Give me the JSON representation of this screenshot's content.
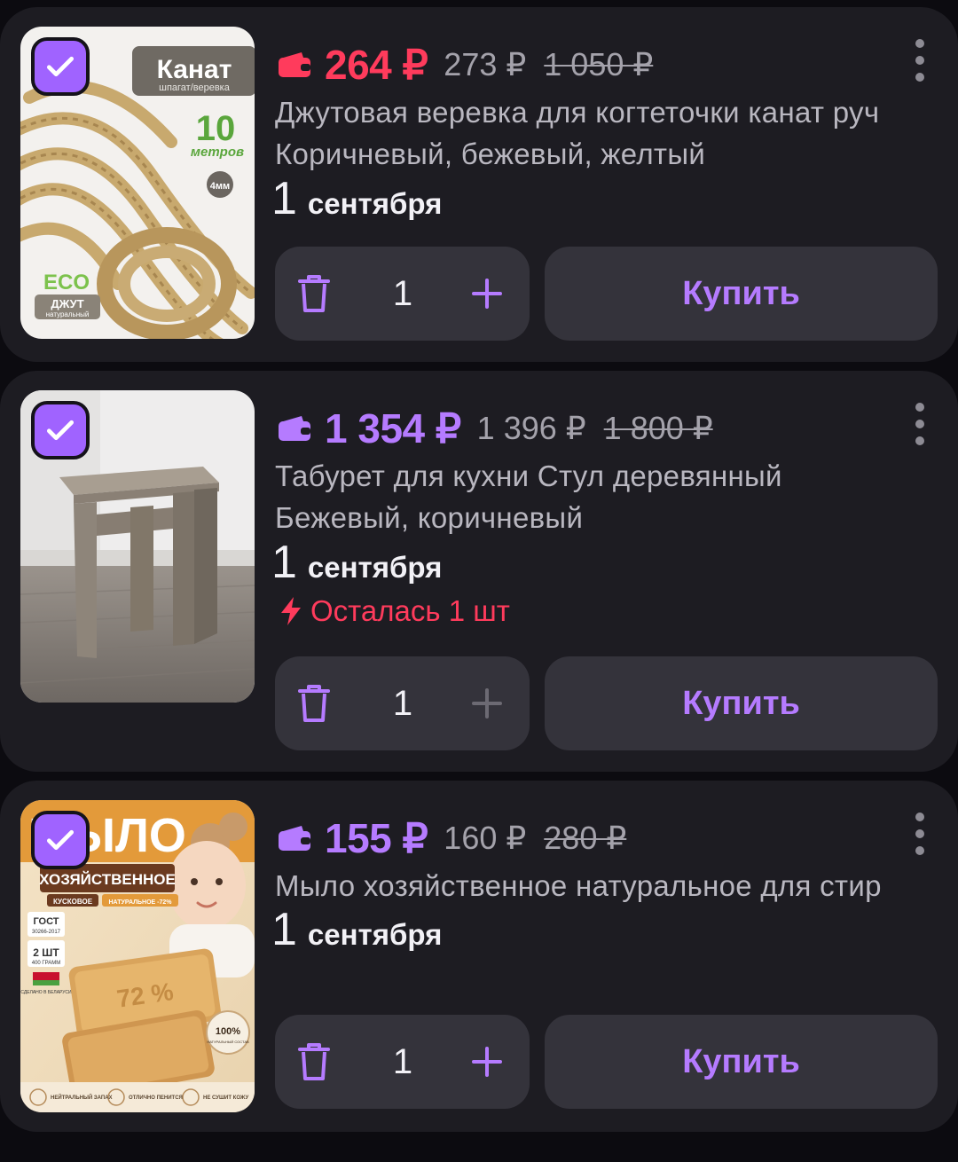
{
  "colors": {
    "background": "#0c0b10",
    "card": "#1d1c22",
    "button": "#34333b",
    "accent_purple": "#b57bff",
    "checkbox": "#a063ff",
    "alert_red": "#ff3b5c"
  },
  "items": [
    {
      "price": "264 ₽",
      "price_color": "red",
      "old_price": "273 ₽",
      "original_price": "1 050 ₽",
      "title": "Джутовая веревка для когтеточки канат руч",
      "variant": "Коричневый, бежевый, желтый",
      "delivery_day": "1",
      "delivery_month": "сентября",
      "stock": "",
      "quantity": "1",
      "buy_label": "Купить",
      "checked": true,
      "image": {
        "brand": "Канат",
        "subtitle": "шпагат/веревка",
        "length": "10",
        "length_unit": "метров",
        "diameter": "4мм",
        "eco": "ECO",
        "material": "ДЖУТ",
        "material_note": "натуральный"
      }
    },
    {
      "price": "1 354 ₽",
      "price_color": "purple",
      "old_price": "1 396 ₽",
      "original_price": "1 800 ₽",
      "title": "Табурет для кухни Стул деревянный",
      "variant": "Бежевый, коричневый",
      "delivery_day": "1",
      "delivery_month": "сентября",
      "stock": "Осталась 1 шт",
      "quantity": "1",
      "buy_label": "Купить",
      "checked": true
    },
    {
      "price": "155 ₽",
      "price_color": "purple",
      "old_price": "160 ₽",
      "original_price": "280 ₽",
      "title": "Мыло хозяйственное натуральное для стир",
      "variant": "",
      "delivery_day": "1",
      "delivery_month": "сентября",
      "stock": "",
      "quantity": "1",
      "buy_label": "Купить",
      "checked": true,
      "image": {
        "brand": "МЫЛО",
        "type": "ХОЗЯЙСТВЕННОЕ",
        "form": "КУСКОВОЕ",
        "natural": "НАТУРАЛЬНОЕ -72%",
        "standard": "ГОСТ",
        "standard_number": "30266-2017",
        "count": "2 ШТ",
        "weight": "400 ГРАММ",
        "origin": "СДЕЛАНО В БЕЛАРУСИ",
        "bar_text": "72 %",
        "badge": "100%",
        "badge_note": "НАТУРАЛЬНЫЙ СОСТАВ",
        "features": [
          "НЕЙТРАЛЬНЫЙ ЗАПАХ",
          "ОТЛИЧНО ПЕНИТСЯ",
          "НЕ СУШИТ КОЖУ"
        ]
      }
    }
  ],
  "icons": {
    "checkbox": "checkmark-icon",
    "wallet": "wallet-icon",
    "more": "more-vertical-icon",
    "delete": "trash-icon",
    "increase": "plus-icon",
    "stock": "lightning-icon"
  }
}
